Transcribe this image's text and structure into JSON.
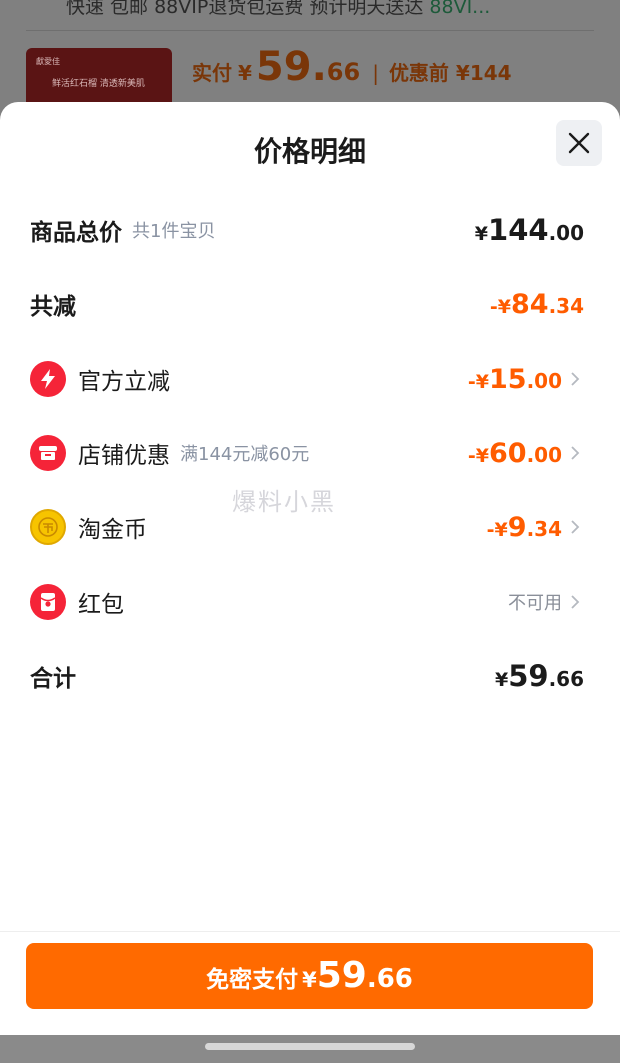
{
  "background": {
    "shipping_text": "快速 包邮 88VIP退货包运费 预计明天送达",
    "shipping_highlight": "88VI...",
    "thumbnail_brand": "獻愛佳",
    "thumbnail_text": "鲜活红石榴 清透新美肌",
    "price_label": "实付",
    "price_symbol": "¥",
    "price_int": "59.",
    "price_dec": "66",
    "divider": "|",
    "original_price": "优惠前 ¥144"
  },
  "sheet": {
    "title": "价格明细",
    "rows": [
      {
        "label": "商品总价",
        "sub": "共1件宝贝",
        "symbol": "¥",
        "int": "144",
        "dec": ".00"
      },
      {
        "label": "共减",
        "symbol": "-¥",
        "int": "84",
        "dec": ".34"
      },
      {
        "label": "官方立减",
        "icon": "lightning-icon",
        "icon_color": "#f52438",
        "symbol": "-¥",
        "int": "15",
        "dec": ".00"
      },
      {
        "label": "店铺优惠",
        "icon": "store-icon",
        "icon_color": "#f52438",
        "sub": "满144元减60元",
        "symbol": "-¥",
        "int": "60",
        "dec": ".00"
      },
      {
        "label": "淘金币",
        "icon": "coin-icon",
        "icon_color": "#f7c400",
        "symbol": "-¥",
        "int": "9",
        "dec": ".34"
      },
      {
        "label": "红包",
        "icon": "red-envelope-icon",
        "icon_color": "#f52438",
        "value_text": "不可用"
      },
      {
        "label": "合计",
        "symbol": "¥",
        "int": "59",
        "dec": ".66"
      }
    ],
    "watermark": "爆料小黑"
  },
  "pay_button": {
    "label": "免密支付",
    "symbol": "¥",
    "int": "59",
    "dec": ".66"
  },
  "colors": {
    "accent": "#ff6a00",
    "discount": "#ff5c00",
    "icon_red": "#f52438",
    "coin_yellow": "#f7c400"
  }
}
